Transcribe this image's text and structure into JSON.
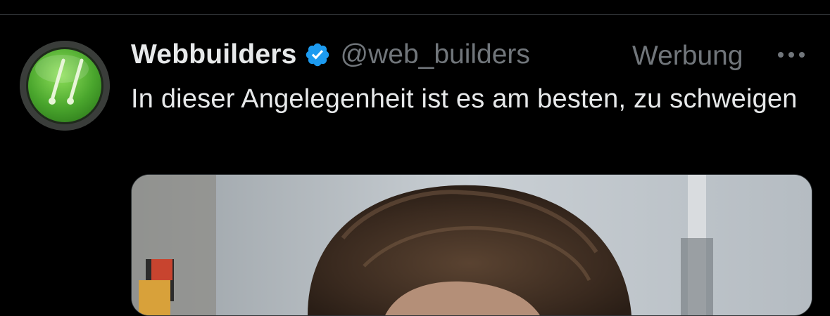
{
  "tweet": {
    "display_name": "Webbuilders",
    "handle": "@web_builders",
    "ad_label": "Werbung",
    "text": "In dieser Angelegenheit ist es am besten, zu schweigen",
    "verified": true
  },
  "icons": {
    "avatar": "webbuilders-logo-icon",
    "verified": "verified-badge-icon",
    "more": "more-options-icon"
  },
  "colors": {
    "background": "#000000",
    "text_primary": "#e7e9ea",
    "text_secondary": "#71767b",
    "verified_blue": "#1d9bf0",
    "avatar_green": "#4ea83a"
  }
}
